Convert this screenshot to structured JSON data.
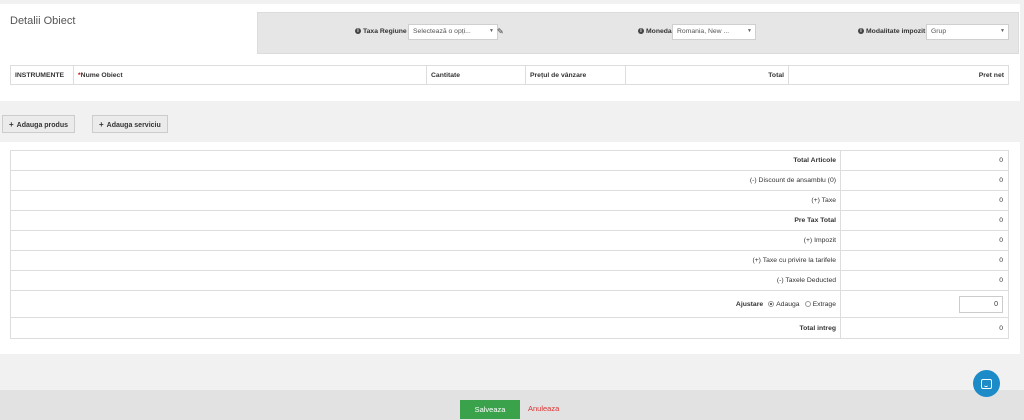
{
  "details": {
    "title": "Detalii Obiect",
    "tax_region": {
      "label": "Taxa Regiune",
      "value": "Selectează o opți..."
    },
    "currency": {
      "label": "Moneda",
      "value": "Romania, New ..."
    },
    "tax_mode": {
      "label": "Modalitate impozit",
      "value": "Grup"
    },
    "columns": [
      "INSTRUMENTE",
      "Nume Obiect",
      "Cantitate",
      "Prețul de vânzare",
      "Total",
      "Pret net"
    ],
    "required_mark": "*"
  },
  "actions": {
    "add_product": "Adauga produs",
    "add_service": "Adauga serviciu"
  },
  "totals": {
    "rows": [
      {
        "label": "Total Articole",
        "value": "0"
      },
      {
        "label": "(-) Discount de ansamblu (0)",
        "value": "0"
      },
      {
        "label": "(+) Taxe",
        "value": "0"
      },
      {
        "label": "Pre Tax Total",
        "value": "0"
      },
      {
        "label": "(+) Impozit",
        "value": "0"
      },
      {
        "label": "(+) Taxe cu privire la tarifele",
        "value": "0"
      },
      {
        "label": "(-) Taxele Deducted",
        "value": "0"
      }
    ],
    "adjust": {
      "label": "Ajustare",
      "option_add": "Adauga",
      "option_subtract": "Extrage",
      "value": "0"
    },
    "grand_total": {
      "label": "Total intreg",
      "value": "0"
    }
  },
  "footer": {
    "save": "Salveaza",
    "cancel": "Anuleaza"
  },
  "colors": {
    "save": "#3aa24b",
    "cancel": "#e03030",
    "chat": "#1c8bc7"
  }
}
